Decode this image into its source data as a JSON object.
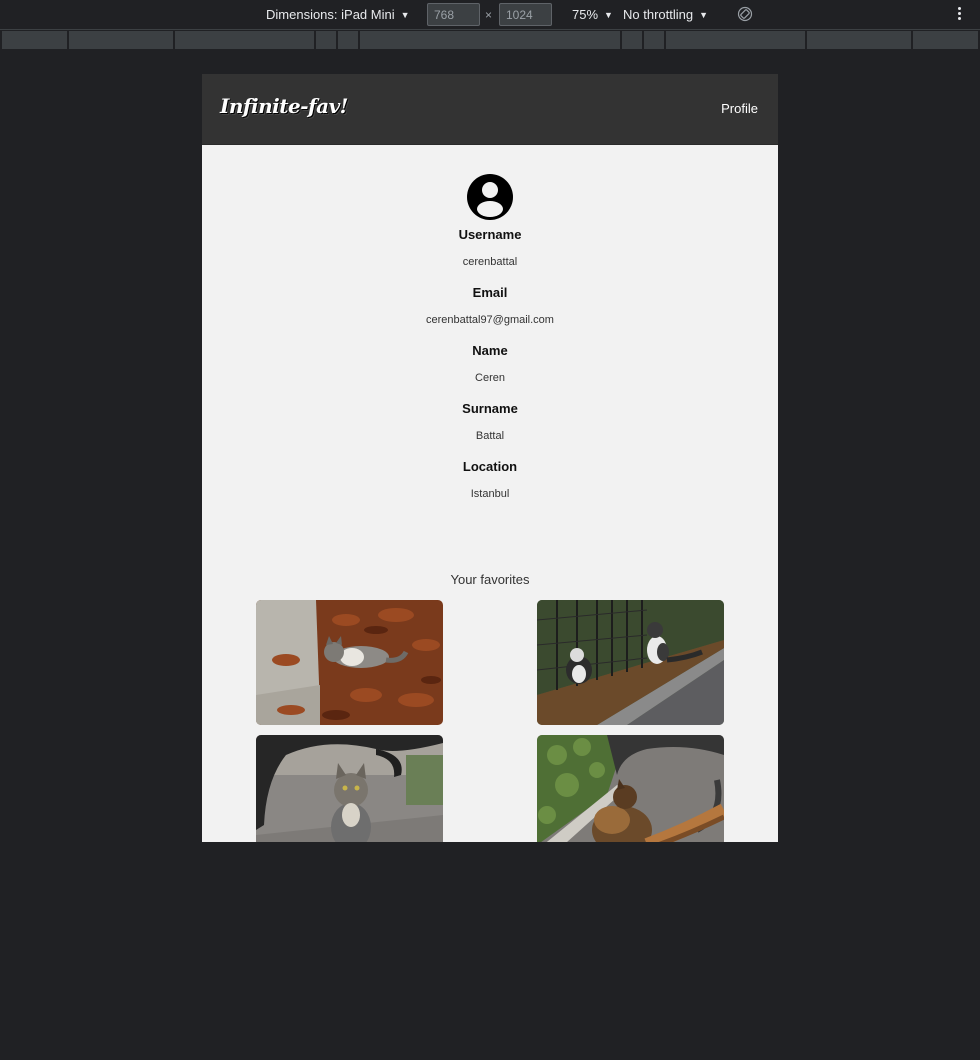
{
  "devtools": {
    "dimensions_label": "Dimensions: iPad Mini",
    "width_value": "768",
    "height_value": "1024",
    "times": "×",
    "zoom_label": "75%",
    "throttling_label": "No throttling"
  },
  "app": {
    "logo": "Infinite-fav!",
    "nav_profile": "Profile"
  },
  "profile": {
    "fields": [
      {
        "label": "Username",
        "value": "cerenbattal"
      },
      {
        "label": "Email",
        "value": "cerenbattal97@gmail.com"
      },
      {
        "label": "Name",
        "value": "Ceren"
      },
      {
        "label": "Surname",
        "value": "Battal"
      },
      {
        "label": "Location",
        "value": "Istanbul"
      }
    ]
  },
  "favorites": {
    "title": "Your favorites",
    "items": [
      {
        "icon": "cat-in-leaves-photo"
      },
      {
        "icon": "cats-by-fence-photo"
      },
      {
        "icon": "cat-under-bench-photo"
      },
      {
        "icon": "ginger-cat-photo"
      }
    ]
  },
  "colors": {
    "header_bg": "#333333",
    "page_bg": "#f2f2f2",
    "outer_bg": "#202124"
  }
}
